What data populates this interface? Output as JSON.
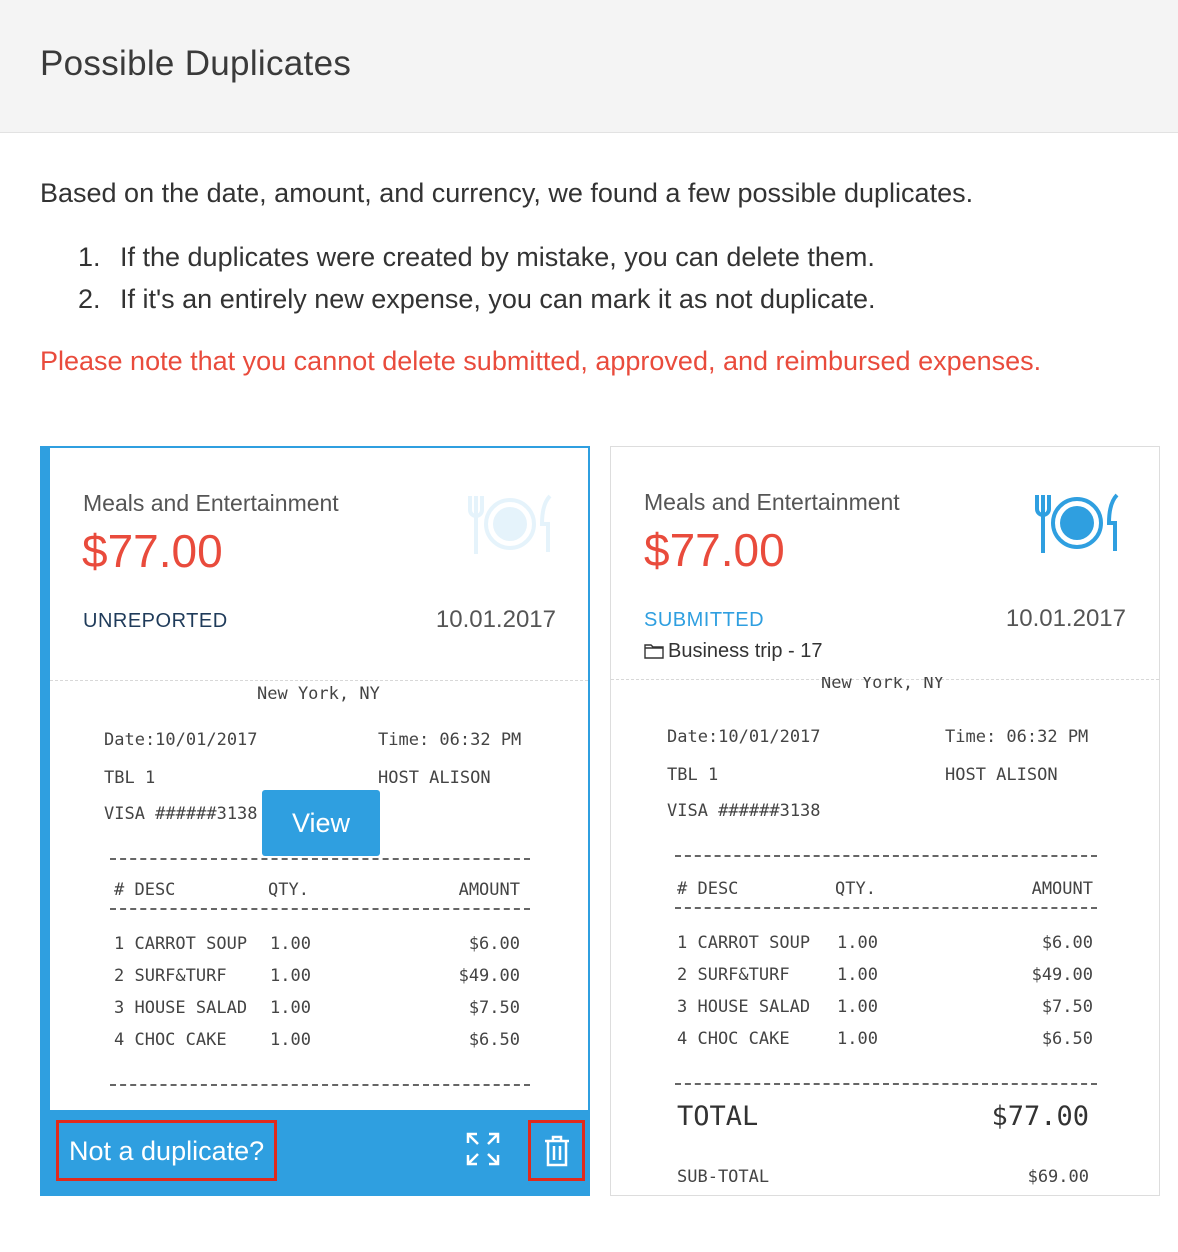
{
  "header": {
    "title": "Possible Duplicates"
  },
  "intro": "Based on the date, amount, and currency, we found a few possible duplicates.",
  "steps": [
    {
      "num": "1.",
      "text": "If the duplicates were created by mistake, you can delete them."
    },
    {
      "num": "2.",
      "text": "If it's an entirely new expense, you can mark it as not duplicate."
    }
  ],
  "warning": "Please note that you cannot delete submitted, approved, and reimbursed expenses.",
  "colors": {
    "accent": "#2f9fe0",
    "amount": "#e94b3c",
    "warning": "#e94b3c",
    "highlight_box": "#e02a1c"
  },
  "cards": [
    {
      "category": "Meals and Entertainment",
      "amount": "$77.00",
      "status": "UNREPORTED",
      "date": "10.01.2017",
      "icon": "meal-icon",
      "view_label": "View",
      "not_duplicate_label": "Not a duplicate?",
      "receipt": {
        "location": "New York, NY",
        "date_line": "Date:10/01/2017",
        "time_line": "Time: 06:32 PM",
        "table": "TBL 1",
        "host": "HOST ALISON",
        "card": "VISA ######3138",
        "headers": [
          "# DESC",
          "QTY.",
          "AMOUNT"
        ],
        "items": [
          {
            "desc": "1 CARROT SOUP",
            "qty": "1.00",
            "amount": "$6.00"
          },
          {
            "desc": "2 SURF&TURF",
            "qty": "1.00",
            "amount": "$49.00"
          },
          {
            "desc": "3 HOUSE SALAD",
            "qty": "1.00",
            "amount": "$7.50"
          },
          {
            "desc": "4 CHOC CAKE",
            "qty": "1.00",
            "amount": "$6.50"
          }
        ]
      }
    },
    {
      "category": "Meals and Entertainment",
      "amount": "$77.00",
      "status": "SUBMITTED",
      "date": "10.01.2017",
      "icon": "meal-icon",
      "report": "Business trip - 17",
      "receipt": {
        "location": "New York, NY",
        "date_line": "Date:10/01/2017",
        "time_line": "Time: 06:32 PM",
        "table": "TBL 1",
        "host": "HOST ALISON",
        "card": "VISA ######3138",
        "headers": [
          "# DESC",
          "QTY.",
          "AMOUNT"
        ],
        "items": [
          {
            "desc": "1 CARROT SOUP",
            "qty": "1.00",
            "amount": "$6.00"
          },
          {
            "desc": "2 SURF&TURF",
            "qty": "1.00",
            "amount": "$49.00"
          },
          {
            "desc": "3 HOUSE SALAD",
            "qty": "1.00",
            "amount": "$7.50"
          },
          {
            "desc": "4 CHOC CAKE",
            "qty": "1.00",
            "amount": "$6.50"
          }
        ],
        "total_label": "TOTAL",
        "total": "$77.00",
        "subtotal_label": "SUB-TOTAL",
        "subtotal": "$69.00"
      }
    }
  ]
}
